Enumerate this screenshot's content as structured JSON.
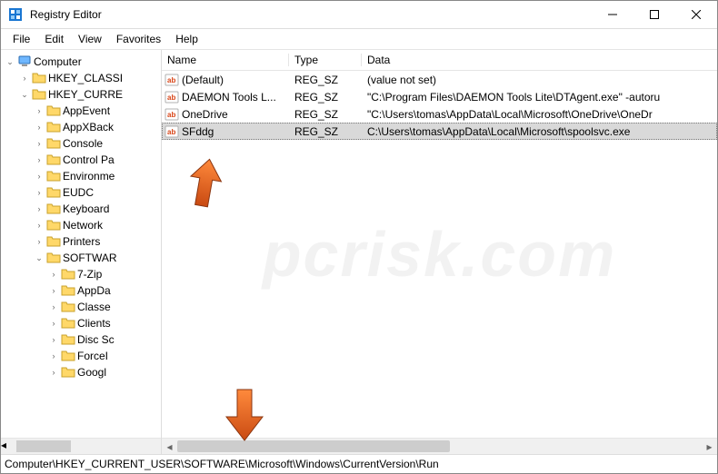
{
  "window": {
    "title": "Registry Editor"
  },
  "menubar": [
    "File",
    "Edit",
    "View",
    "Favorites",
    "Help"
  ],
  "tree": {
    "root": "Computer",
    "hives": [
      {
        "label": "HKEY_CLASSI",
        "expanded": false
      },
      {
        "label": "HKEY_CURRE",
        "expanded": true
      }
    ],
    "children": [
      "AppEvent",
      "AppXBack",
      "Console",
      "Control Pa",
      "Environme",
      "EUDC",
      "Keyboard",
      "Network",
      "Printers"
    ],
    "software": {
      "label": "SOFTWAR",
      "expanded": true
    },
    "software_children": [
      "7-Zip",
      "AppDa",
      "Classe",
      "Clients",
      "Disc Sc",
      "ForceI",
      "Googl"
    ]
  },
  "columns": {
    "name": "Name",
    "type": "Type",
    "data": "Data"
  },
  "values": [
    {
      "name": "(Default)",
      "type": "REG_SZ",
      "data": "(value not set)",
      "sel": false
    },
    {
      "name": "DAEMON Tools L...",
      "type": "REG_SZ",
      "data": "\"C:\\Program Files\\DAEMON Tools Lite\\DTAgent.exe\" -autoru",
      "sel": false
    },
    {
      "name": "OneDrive",
      "type": "REG_SZ",
      "data": "\"C:\\Users\\tomas\\AppData\\Local\\Microsoft\\OneDrive\\OneDr",
      "sel": false
    },
    {
      "name": "SFddg",
      "type": "REG_SZ",
      "data": "C:\\Users\\tomas\\AppData\\Local\\Microsoft\\spoolsvc.exe",
      "sel": true
    }
  ],
  "statusbar": "Computer\\HKEY_CURRENT_USER\\SOFTWARE\\Microsoft\\Windows\\CurrentVersion\\Run",
  "watermark": "pcrisk.com"
}
